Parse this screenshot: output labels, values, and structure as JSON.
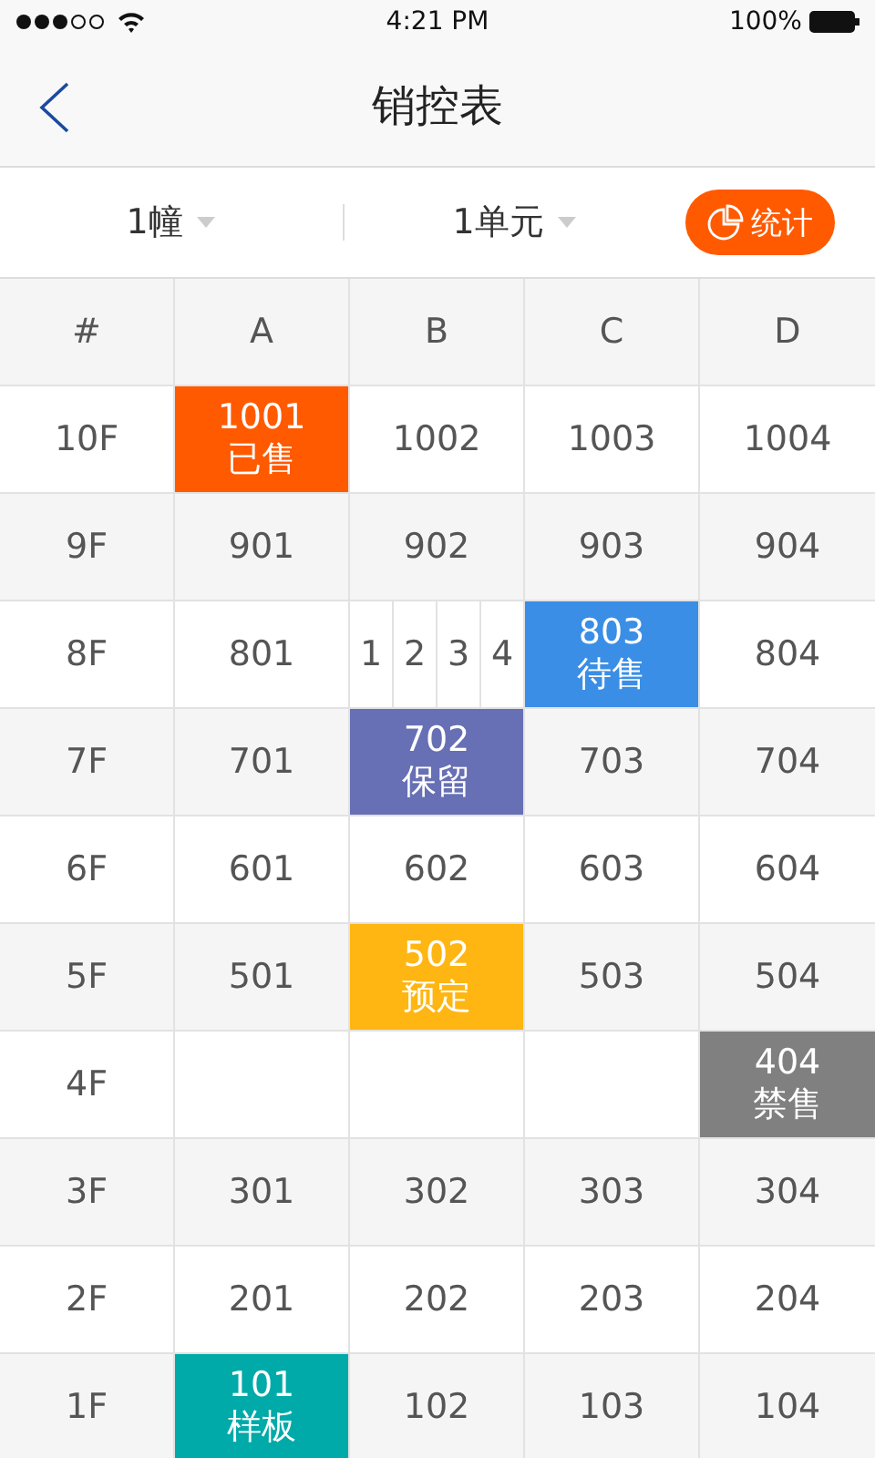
{
  "status_bar": {
    "time": "4:21 PM",
    "battery": "100%"
  },
  "nav": {
    "title": "销控表"
  },
  "filters": [
    {
      "label": "1幢"
    },
    {
      "label": "1单元"
    }
  ],
  "stats_button": {
    "label": "统计"
  },
  "table": {
    "corner": "#",
    "columns": [
      "A",
      "B",
      "C",
      "D"
    ],
    "rows": [
      {
        "floor": "10F",
        "cells": [
          {
            "kind": "unit",
            "number": "1001",
            "status": "已售",
            "color": "#ff5a00"
          },
          {
            "kind": "unit",
            "number": "1002"
          },
          {
            "kind": "unit",
            "number": "1003"
          },
          {
            "kind": "unit",
            "number": "1004"
          }
        ]
      },
      {
        "floor": "9F",
        "cells": [
          {
            "kind": "unit",
            "number": "901"
          },
          {
            "kind": "unit",
            "number": "902"
          },
          {
            "kind": "unit",
            "number": "903"
          },
          {
            "kind": "unit",
            "number": "904"
          }
        ]
      },
      {
        "floor": "8F",
        "cells": [
          {
            "kind": "unit",
            "number": "801"
          },
          {
            "kind": "split",
            "parts": [
              "1",
              "2",
              "3",
              "4"
            ]
          },
          {
            "kind": "unit",
            "number": "803",
            "status": "待售",
            "color": "#3a8ee6"
          },
          {
            "kind": "unit",
            "number": "804"
          }
        ]
      },
      {
        "floor": "7F",
        "cells": [
          {
            "kind": "unit",
            "number": "701"
          },
          {
            "kind": "unit",
            "number": "702",
            "status": "保留",
            "color": "#6770b5"
          },
          {
            "kind": "unit",
            "number": "703"
          },
          {
            "kind": "unit",
            "number": "704"
          }
        ]
      },
      {
        "floor": "6F",
        "cells": [
          {
            "kind": "unit",
            "number": "601"
          },
          {
            "kind": "unit",
            "number": "602"
          },
          {
            "kind": "unit",
            "number": "603"
          },
          {
            "kind": "unit",
            "number": "604"
          }
        ]
      },
      {
        "floor": "5F",
        "cells": [
          {
            "kind": "unit",
            "number": "501"
          },
          {
            "kind": "unit",
            "number": "502",
            "status": "预定",
            "color": "#ffb612"
          },
          {
            "kind": "unit",
            "number": "503"
          },
          {
            "kind": "unit",
            "number": "504"
          }
        ]
      },
      {
        "floor": "4F",
        "cells": [
          {
            "kind": "empty"
          },
          {
            "kind": "empty"
          },
          {
            "kind": "empty"
          },
          {
            "kind": "unit",
            "number": "404",
            "status": "禁售",
            "color": "#808080"
          }
        ]
      },
      {
        "floor": "3F",
        "cells": [
          {
            "kind": "unit",
            "number": "301"
          },
          {
            "kind": "unit",
            "number": "302"
          },
          {
            "kind": "unit",
            "number": "303"
          },
          {
            "kind": "unit",
            "number": "304"
          }
        ]
      },
      {
        "floor": "2F",
        "cells": [
          {
            "kind": "unit",
            "number": "201"
          },
          {
            "kind": "unit",
            "number": "202"
          },
          {
            "kind": "unit",
            "number": "203"
          },
          {
            "kind": "unit",
            "number": "204"
          }
        ]
      },
      {
        "floor": "1F",
        "cells": [
          {
            "kind": "unit",
            "number": "101",
            "status": "样板",
            "color": "#00aaa8"
          },
          {
            "kind": "unit",
            "number": "102"
          },
          {
            "kind": "unit",
            "number": "103"
          },
          {
            "kind": "unit",
            "number": "104"
          }
        ]
      }
    ]
  }
}
